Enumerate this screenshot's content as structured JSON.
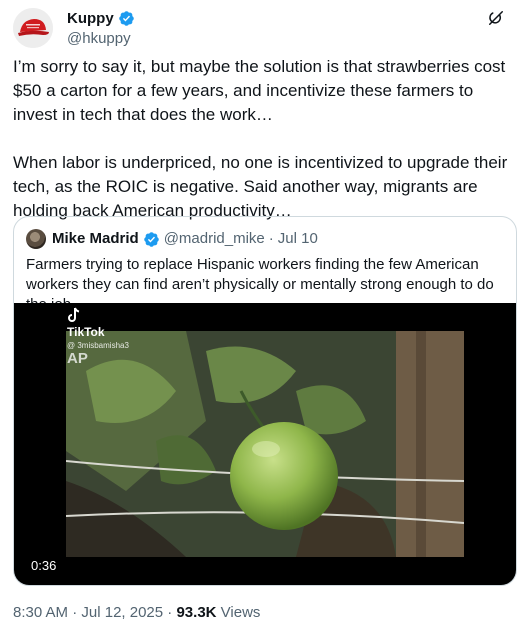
{
  "author": {
    "display_name": "Kuppy",
    "handle": "@hkuppy"
  },
  "tweet": {
    "paragraph1": "I’m sorry to say it, but maybe the solution is that strawberries cost $50 a carton for a few years, and incentivize these farmers to invest in tech that does the work…",
    "paragraph2": "When labor is underpriced, no one is incentivized to upgrade their tech, as the ROIC is negative. Said another way, migrants are holding back American productivity…"
  },
  "quote": {
    "display_name": "Mike Madrid",
    "handle": "@madrid_mike",
    "separator": "·",
    "date": "Jul 10",
    "text": "Farmers trying to replace Hispanic workers finding the few American workers they can find aren’t physically or mentally strong enough to do the job",
    "video": {
      "watermark_brand": "TikTok",
      "watermark_handle": "@ 3misbamisha3",
      "watermark_ap": "AP",
      "duration": "0:36"
    }
  },
  "footer": {
    "time": "8:30 AM",
    "separator": "·",
    "date": "Jul 12, 2025",
    "views_count": "93.3K",
    "views_label": "Views"
  },
  "colors": {
    "verified_badge": "#1d9bf0",
    "secondary_text": "#536471",
    "border": "#cfd9de"
  }
}
